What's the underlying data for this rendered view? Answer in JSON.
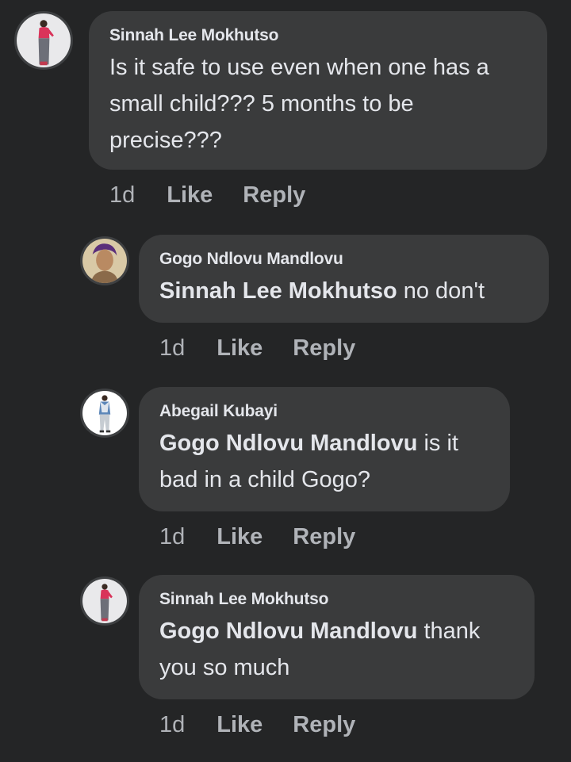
{
  "comments": [
    {
      "author": "Sinnah Lee Mokhutso",
      "mention": "",
      "text": "Is it safe to use even when one has a small child??? 5 months to be precise???",
      "time": "1d",
      "like": "Like",
      "reply": "Reply",
      "avatar": "woman-standing-pink-top-avatar"
    },
    {
      "author": "Gogo Ndlovu Mandlovu",
      "mention": "Sinnah Lee Mokhutso",
      "text": " no don't",
      "time": "1d",
      "like": "Like",
      "reply": "Reply",
      "avatar": "woman-portrait-avatar"
    },
    {
      "author": "Abegail Kubayi",
      "mention": "Gogo Ndlovu Mandlovu",
      "text": " is it bad in a child Gogo?",
      "time": "1d",
      "like": "Like",
      "reply": "Reply",
      "avatar": "person-denim-jacket-avatar"
    },
    {
      "author": "Sinnah Lee Mokhutso",
      "mention": "Gogo Ndlovu Mandlovu",
      "text": " thank you so much",
      "time": "1d",
      "like": "Like",
      "reply": "Reply",
      "avatar": "woman-standing-pink-top-avatar"
    }
  ],
  "colors": {
    "background": "#242526",
    "bubble": "#3a3b3c",
    "text": "#e4e6eb",
    "secondary": "#b0b3b8"
  }
}
